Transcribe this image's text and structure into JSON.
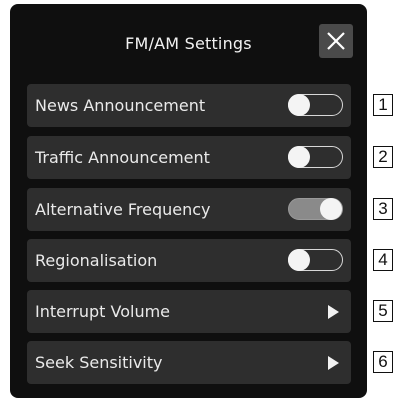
{
  "dialog": {
    "title": "FM/AM Settings",
    "close_icon": "close-icon"
  },
  "settings": [
    {
      "label": "News Announcement",
      "control": "toggle",
      "state": "off",
      "callout": "1"
    },
    {
      "label": "Traffic Announcement",
      "control": "toggle",
      "state": "off",
      "callout": "2"
    },
    {
      "label": "Alternative Frequency",
      "control": "toggle",
      "state": "on",
      "callout": "3"
    },
    {
      "label": "Regionalisation",
      "control": "toggle",
      "state": "off",
      "callout": "4"
    },
    {
      "label": "Interrupt Volume",
      "control": "arrow",
      "icon": "chevron-right-icon",
      "callout": "5"
    },
    {
      "label": "Seek Sensitivity",
      "control": "arrow",
      "icon": "chevron-right-icon",
      "callout": "6"
    }
  ],
  "colors": {
    "panel_bg": "#0f0f0f",
    "row_bg": "#2e2e2e",
    "text": "#eaeaea",
    "toggle_on": "#8a8a8a"
  }
}
